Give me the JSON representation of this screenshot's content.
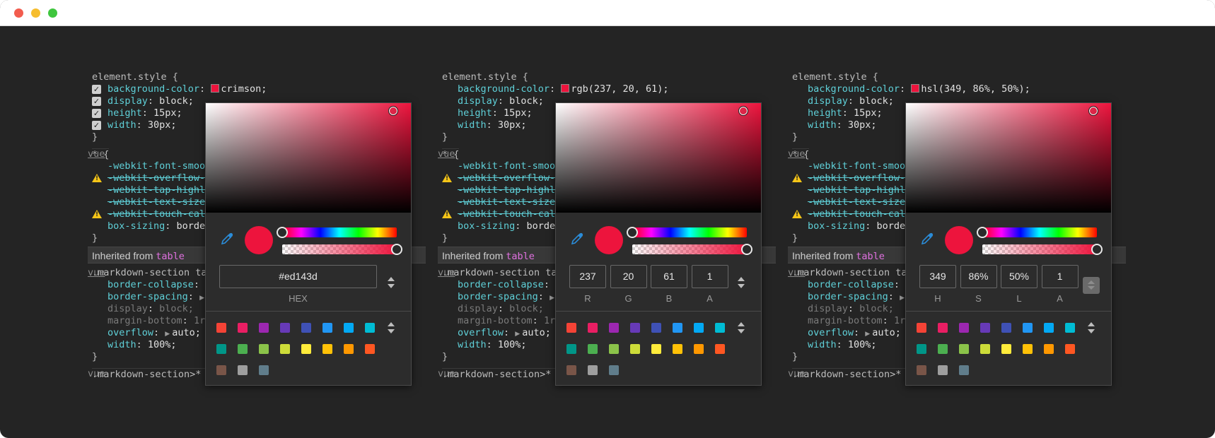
{
  "rules": {
    "element_style": {
      "selector": "element.style {",
      "properties": [
        {
          "name": "display",
          "value": "block;"
        },
        {
          "name": "height",
          "value": "15px;"
        },
        {
          "name": "width",
          "value": "30px;"
        }
      ],
      "bg_property": "background-color"
    },
    "universal": {
      "selector": "* {",
      "props": [
        "-webkit-font-smoo",
        "-webkit-overflow-",
        "-webkit-tap-highl",
        "-webkit-text-size",
        "-webkit-touch-cal"
      ],
      "box_sizing_name": "box-sizing",
      "box_sizing_value": "borde"
    },
    "close": "}",
    "inherited_label": "Inherited from",
    "inherited_table": "table",
    "markdown_section": {
      "selector": ".markdown-section ta",
      "props": [
        {
          "name": "border-collapse",
          "value": ""
        },
        {
          "name": "border-spacing",
          "value": ""
        },
        {
          "name": "display",
          "value": "block;"
        },
        {
          "name": "margin-bottom",
          "value": "1r"
        },
        {
          "name": "overflow",
          "value": "auto;"
        },
        {
          "name": "width",
          "value": "100%;"
        }
      ]
    },
    "markdown_section_star": ".markdown-section>* {",
    "vue_link": "vue"
  },
  "panels": [
    {
      "bg_value": "crimson;",
      "mode": "hex",
      "fields": [
        {
          "value": "#ed143d",
          "label": "HEX"
        }
      ]
    },
    {
      "bg_value": "rgb(237, 20, 61);",
      "mode": "rgba",
      "fields": [
        {
          "value": "237",
          "label": "R"
        },
        {
          "value": "20",
          "label": "G"
        },
        {
          "value": "61",
          "label": "B"
        },
        {
          "value": "1",
          "label": "A"
        }
      ]
    },
    {
      "bg_value": "hsl(349, 86%, 50%);",
      "mode": "hsla",
      "fields": [
        {
          "value": "349",
          "label": "H"
        },
        {
          "value": "86%",
          "label": "S"
        },
        {
          "value": "50%",
          "label": "L"
        },
        {
          "value": "1",
          "label": "A"
        }
      ]
    }
  ],
  "colors": {
    "current": "#ed143d",
    "palette": [
      "#f44336",
      "#e91e63",
      "#9c27b0",
      "#673ab7",
      "#3f51b5",
      "#2196f3",
      "#03a9f4",
      "#00bcd4",
      "#009688",
      "#4caf50",
      "#8bc34a",
      "#cddc39",
      "#ffeb3b",
      "#ffc107",
      "#ff9800",
      "#ff5722",
      "#795548",
      "#9e9e9e",
      "#607d8b"
    ]
  },
  "icons": {
    "eyedropper": "eyedropper-icon",
    "warning": "warning-icon",
    "checkbox": "checkbox-icon",
    "stepper": "stepper-icon"
  }
}
